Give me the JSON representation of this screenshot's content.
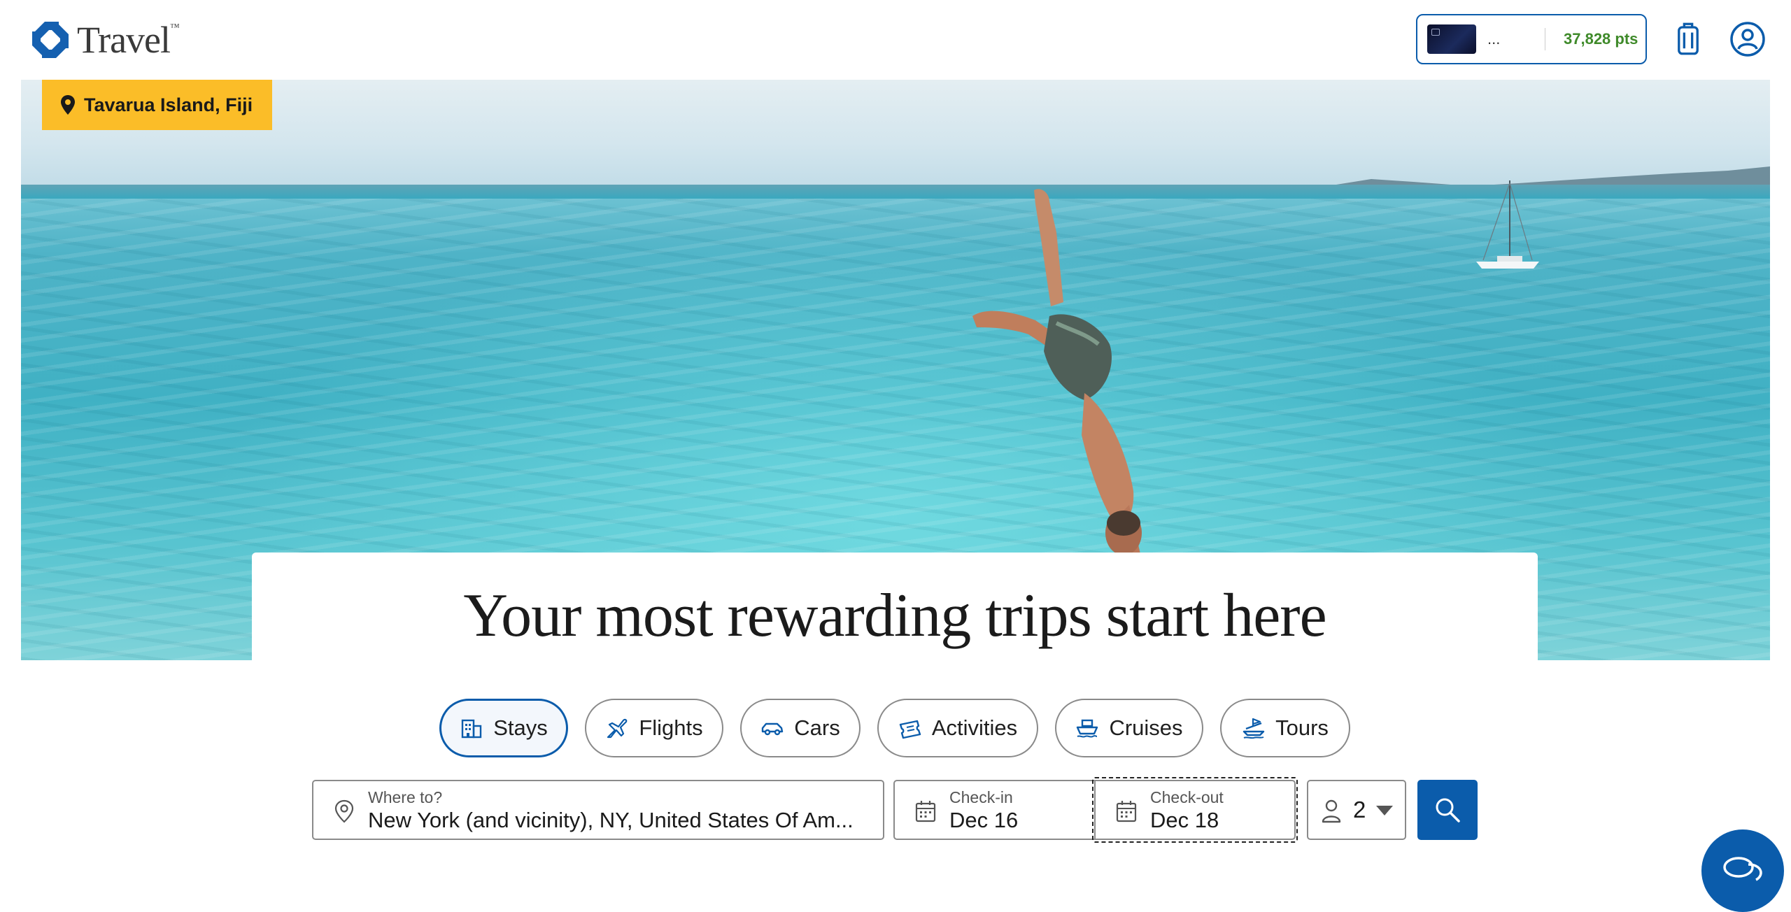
{
  "header": {
    "logo_text": "Travel",
    "logo_tm": "™",
    "account": {
      "card_name": "...",
      "points": "37,828 pts"
    },
    "icons": [
      "luggage-icon",
      "account-icon"
    ]
  },
  "hero": {
    "location": "Tavarua Island, Fiji",
    "title": "Your most rewarding trips start here"
  },
  "tabs": [
    {
      "label": "Stays",
      "icon": "building-icon",
      "active": true
    },
    {
      "label": "Flights",
      "icon": "plane-icon",
      "active": false
    },
    {
      "label": "Cars",
      "icon": "car-icon",
      "active": false
    },
    {
      "label": "Activities",
      "icon": "ticket-icon",
      "active": false
    },
    {
      "label": "Cruises",
      "icon": "ship-icon",
      "active": false
    },
    {
      "label": "Tours",
      "icon": "tour-icon",
      "active": false
    }
  ],
  "search": {
    "destination": {
      "label": "Where to?",
      "value": "New York (and vicinity), NY, United States Of Am..."
    },
    "checkin": {
      "label": "Check-in",
      "value": "Dec 16"
    },
    "checkout": {
      "label": "Check-out",
      "value": "Dec 18"
    },
    "travelers": {
      "value": "2"
    }
  },
  "colors": {
    "brand_blue": "#0b5cab",
    "location_tag": "#fbbd28",
    "points_green": "#3f8a2a"
  }
}
